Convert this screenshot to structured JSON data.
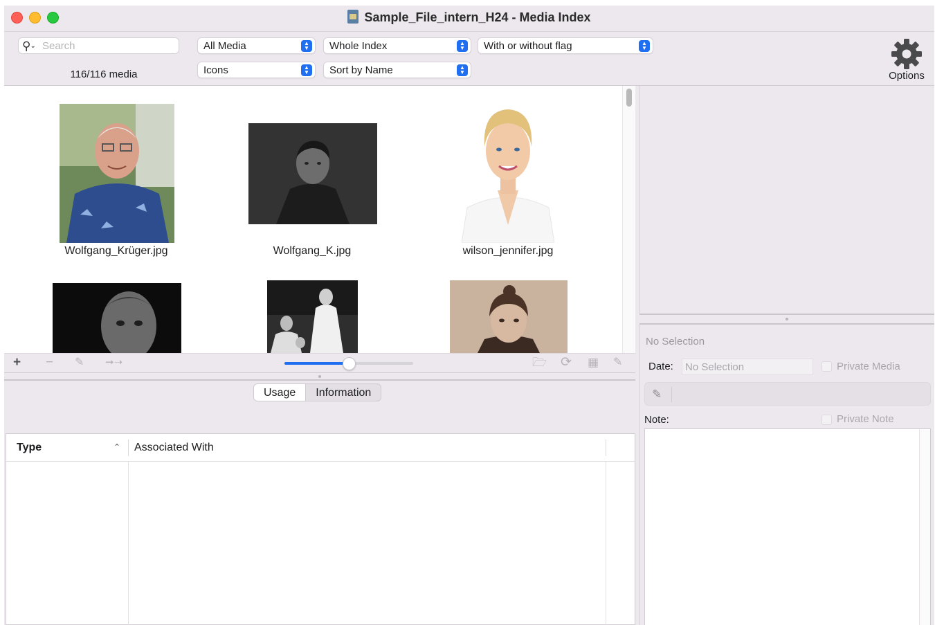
{
  "window": {
    "title": "Sample_File_intern_H24 - Media Index"
  },
  "toolbar": {
    "search_placeholder": "Search",
    "media_count": "116/116 media",
    "media_filter": "All Media",
    "scope_filter": "Whole Index",
    "flag_filter": "With or without flag",
    "view_mode": "Icons",
    "sort_mode": "Sort by Name",
    "options_label": "Options"
  },
  "media_items": [
    {
      "name": "Wolfgang_Krüger.jpg"
    },
    {
      "name": "Wolfgang_K.jpg"
    },
    {
      "name": "wilson_jennifer.jpg"
    },
    {
      "name": ""
    },
    {
      "name": ""
    },
    {
      "name": ""
    }
  ],
  "thumbnail_size": {
    "level": 0.5
  },
  "bottom_tabs": {
    "usage": "Usage",
    "information": "Information",
    "selected": "Usage"
  },
  "usage_table": {
    "columns": [
      "Type",
      "Associated With"
    ],
    "sort_column": "Type",
    "sort_direction": "ascending",
    "rows": []
  },
  "details": {
    "header": "No Selection",
    "date_label": "Date:",
    "date_placeholder": "No Selection",
    "private_media_label": "Private Media",
    "note_label": "Note:",
    "private_note_label": "Private Note"
  }
}
